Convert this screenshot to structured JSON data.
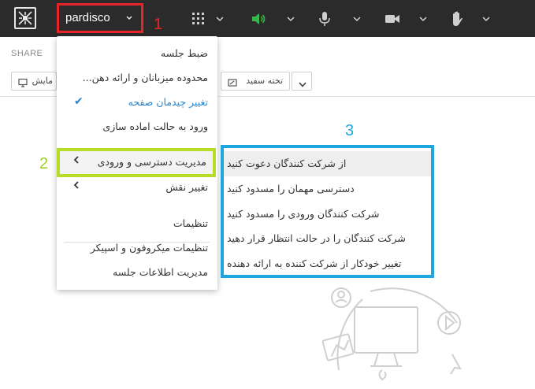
{
  "topbar": {
    "room_name": "pardisco",
    "icons": [
      "logo-icon",
      "apps-grid-icon",
      "speaker-icon",
      "microphone-icon",
      "camera-icon",
      "raise-hand-icon"
    ],
    "audio_color": "#39b54a"
  },
  "callouts": {
    "one": "1",
    "two": "2",
    "three": "3"
  },
  "share": {
    "label": "SHARE",
    "present_label": "مایش",
    "whiteboard_label": "تخته سفید"
  },
  "menu": {
    "items": [
      {
        "label": "ضبط جلسه"
      },
      {
        "label": "محدوده میزبانان و ارائه دهن..."
      },
      {
        "label": "تغییر چیدمان صفحه",
        "checked": true
      },
      {
        "label": "ورود به حالت اماده سازی"
      },
      {
        "label": "مدیریت دسترسی و ورودی",
        "submenu": true
      },
      {
        "label": "تغییر نقش",
        "submenu": true
      },
      {
        "label": "تنظیمات"
      },
      {
        "label": "تنظیمات میکروفون و اسپیکر"
      },
      {
        "label": "مدیریت اطلاعات جلسه"
      }
    ]
  },
  "submenu": {
    "items": [
      {
        "label": "از شرکت کنندگان دعوت کنید"
      },
      {
        "label": "دسترسی مهمان را مسدود کنید"
      },
      {
        "label": "شرکت کنندگان ورودی را مسدود کنید"
      },
      {
        "label": "شرکت کنندگان را در حالت انتظار قرار دهید"
      },
      {
        "label": "تغییر خودکار از شرکت کننده به ارائه دهنده"
      }
    ]
  },
  "colors": {
    "highlight_red": "#e8242b",
    "highlight_green": "#b5dd2a",
    "highlight_blue": "#1ea6df",
    "accent": "#2c85c9"
  }
}
